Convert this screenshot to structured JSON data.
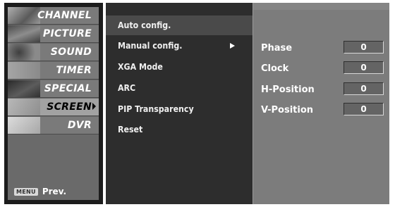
{
  "left_menu": {
    "items": [
      {
        "label": "CHANNEL",
        "thumb": "#8a8a8a"
      },
      {
        "label": "PICTURE",
        "thumb": "#5f5f5f"
      },
      {
        "label": "SOUND",
        "thumb": "#6f6f6f"
      },
      {
        "label": "TIMER",
        "thumb": "#8c8c8c"
      },
      {
        "label": "SPECIAL",
        "thumb": "#3a3a3a"
      },
      {
        "label": "SCREEN",
        "thumb": "#9c9c9c"
      },
      {
        "label": "DVR",
        "thumb": "#b5b5b5"
      }
    ],
    "selected_index": 5,
    "menu_key": "MENU",
    "prev_label": "Prev."
  },
  "mid_menu": {
    "items": [
      "Auto config.",
      "Manual config.",
      "XGA Mode",
      "ARC",
      "PIP Transparency",
      "Reset"
    ],
    "highlighted_index": 0,
    "arrow_index": 1
  },
  "settings": {
    "rows": [
      {
        "label": "Phase",
        "value": "0"
      },
      {
        "label": "Clock",
        "value": "0"
      },
      {
        "label": "H-Position",
        "value": "0"
      },
      {
        "label": "V-Position",
        "value": "0"
      }
    ]
  }
}
